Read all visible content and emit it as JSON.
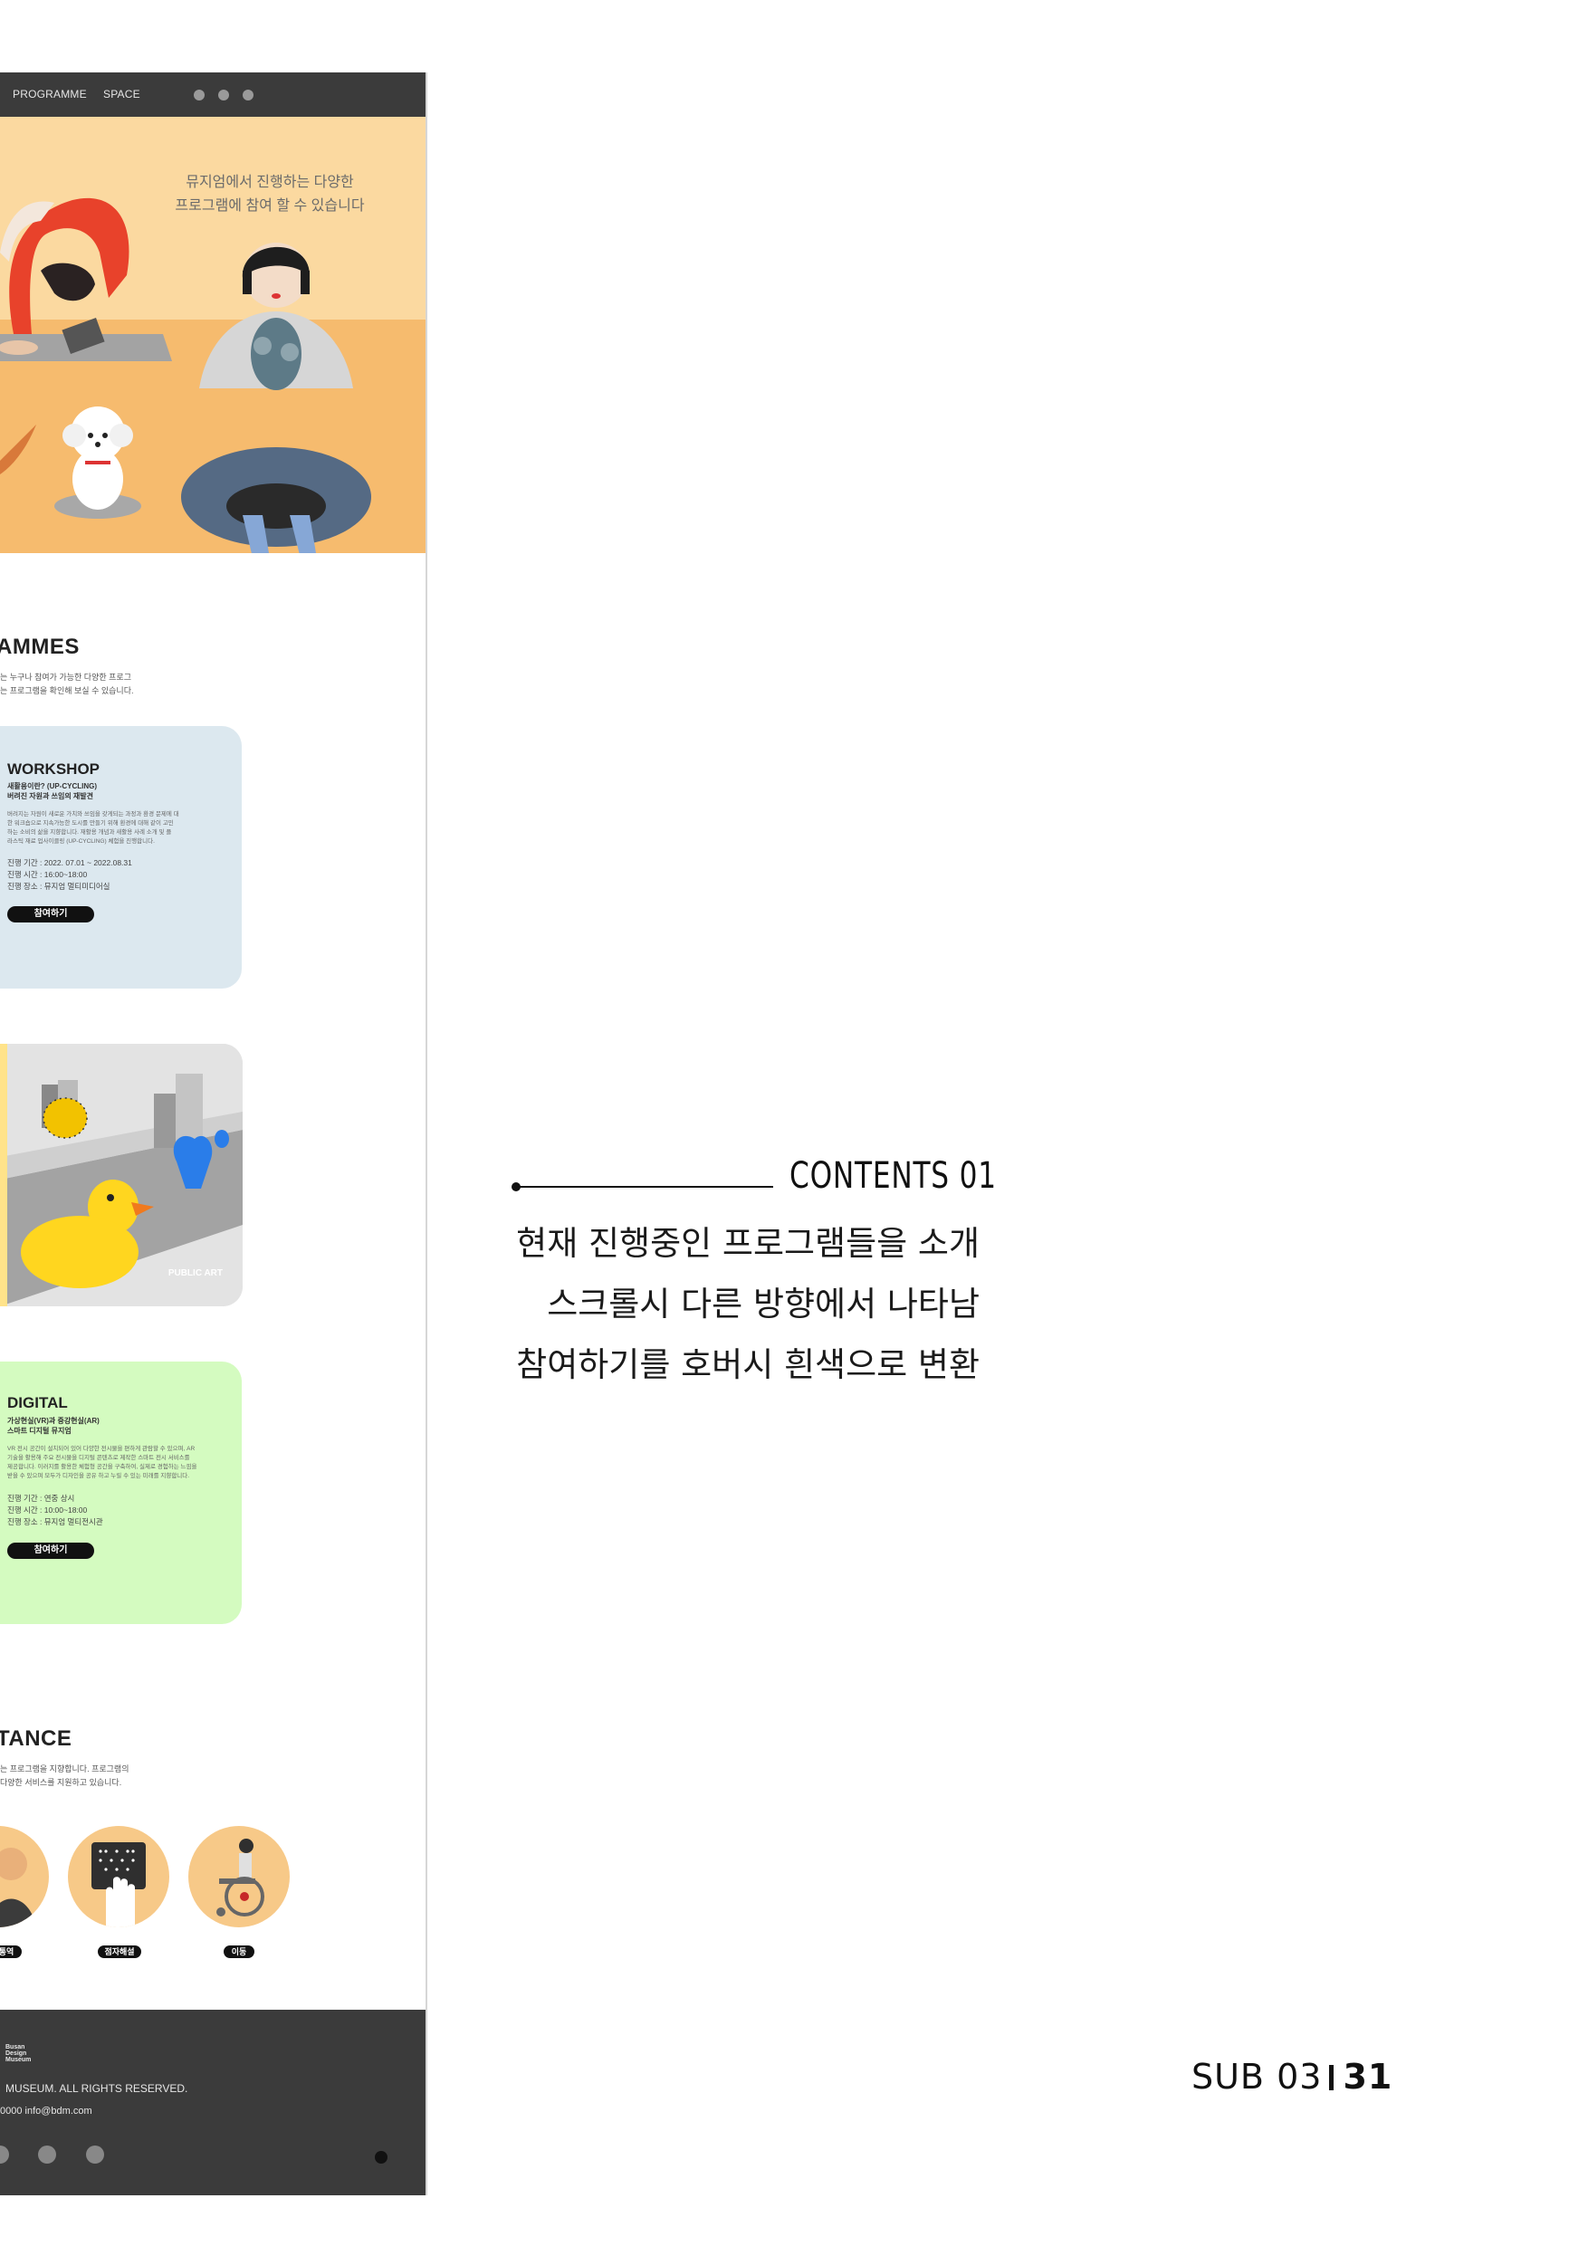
{
  "nav": {
    "links": [
      "PROGRAMME",
      "SPACE"
    ]
  },
  "hero": {
    "lines": [
      "뮤지엄에서 진행하는 다양한",
      "프로그램에 참여 할 수 있습니다"
    ]
  },
  "programmes": {
    "title": "AMMES",
    "desc": [
      "는 누구나 참여가 가능한 다양한 프로그",
      "는 프로그램을 확인해 보실 수 있습니다."
    ]
  },
  "workshop": {
    "title": "WORKSHOP",
    "subtitle": [
      "새활용이란? (UP-CYCLING)",
      "버려진 자원과 쓰임의 재발견"
    ],
    "body": [
      "버려지는 자원이 새로운 가치와 쓰임을 갖게되는 과정과 환경 문제에 대",
      "한 워크숍으로 지속가능한 도시를 만들기 위해 환경에 대해 같이 고민",
      "하는 소비의 삶을 지향합니다. 재활용 개념과 새활용 사례 소개 및 플",
      "라스틱 재료 업사이클링 (UP-CYCLING) 체험을 진행합니다."
    ],
    "info": [
      "진행 기간 :   2022. 07.01 ~ 2022.08.31",
      "진행 시간 :   16:00~18:00",
      "진행 장소 :   뮤지엄 멀티미디어실"
    ],
    "button": "참여하기",
    "color": "#dce8ef"
  },
  "public_art": {
    "label": "PUBLIC ART"
  },
  "digital": {
    "title": "DIGITAL",
    "subtitle": [
      "가상현실(VR)과 증강현실(AR)",
      "스마트 디지털 뮤지엄"
    ],
    "body": [
      "VR 전시 공간이 설치되어 있어 다양한 전시물을 편하게 관람할 수 있으며, AR",
      "기술을 활용해 주요 전시물을 디지털 콘텐츠로 제작한 스마트 전시 서비스를",
      "제공합니다. 이러지를 활용한 체험형 공간을 구축하여, 실제로 경험하는 느낌을",
      "받을 수 있으며 모두가 디자인을 공유 하고 누릴 수 있는 미래를 지향합니다."
    ],
    "info": [
      "진행 기간 :   연중 상시",
      "진행 시간 :   10:00~18:00",
      "진행 장소 :   뮤지엄 멀티전시관"
    ],
    "button": "참여하기",
    "color": "#d4fbc0"
  },
  "assistance": {
    "title": "TANCE",
    "desc": [
      "는 프로그램을 지향합니다. 프로그램의",
      "다양한 서비스를 지원하고 있습니다."
    ],
    "items": [
      "통역",
      "점자해설",
      "이동"
    ]
  },
  "footer": {
    "logo": [
      "Busan",
      "Design",
      "Museum"
    ],
    "rights": "MUSEUM. ALL RIGHTS RESERVED.",
    "contact": "0000   info@bdm.com"
  },
  "contents": {
    "title": "CONTENTS 01",
    "lines": [
      "현재 진행중인 프로그램들을 소개",
      "스크롤시 다른 방향에서 나타남",
      "참여하기를 호버시 흰색으로 변환"
    ]
  },
  "page": {
    "section": "SUB 03",
    "number": "31"
  }
}
